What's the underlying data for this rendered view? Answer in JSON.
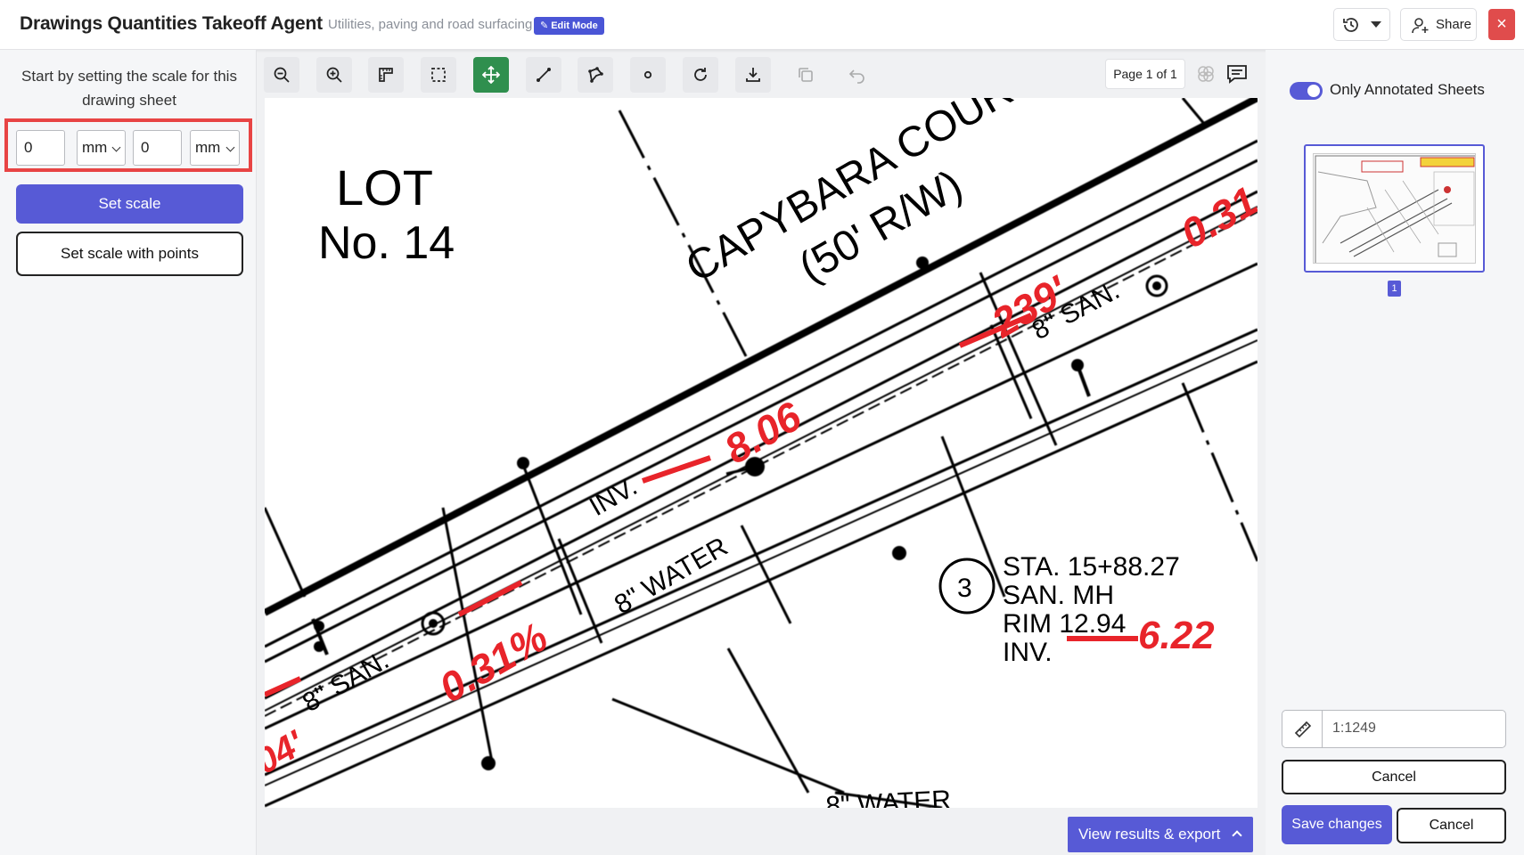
{
  "header": {
    "title": "Drawings Quantities Takeoff Agent",
    "subtitle": "Utilities, paving and road surfacing",
    "mode_badge": "Edit Mode",
    "share_label": "Share",
    "close_label": "×"
  },
  "left_panel": {
    "instruction": "Start by setting the scale for this drawing sheet",
    "scale": {
      "value1": "0",
      "unit1": "mm",
      "value2": "0",
      "unit2": "mm"
    },
    "set_scale_label": "Set scale",
    "set_scale_points_label": "Set scale with points"
  },
  "toolbar": {
    "tools": [
      "zoom-out",
      "zoom-in",
      "ruler-corner",
      "select-area",
      "pan-move",
      "line-measure",
      "polygon-measure",
      "count-point",
      "refresh",
      "download",
      "copy",
      "undo"
    ],
    "active_tool": "pan-move",
    "page_indicator": "Page 1 of 1"
  },
  "drawing": {
    "lot_line1": "LOT",
    "lot_line2": "No.  14",
    "street_name": "CAPYBARA COUR",
    "right_of_way": "(50' R/W)",
    "inv_label": "INV.",
    "inv_value_red": "8.06",
    "elev_239": "239'",
    "slope_031_top": "0.31",
    "slope_031": "0.31%",
    "san_label": "8\" SAN.",
    "water_label": "8\" WATER",
    "water_label_bottom": "8\" WATER",
    "neg_04": "04'",
    "station_number": "3",
    "station_lines": [
      "STA.  15+88.27",
      "SAN.  MH",
      "RIM  12.94",
      "INV."
    ],
    "inv_new_red": "6.22"
  },
  "footer": {
    "results_export_label": "View results & export"
  },
  "right_panel": {
    "toggle_label": "Only Annotated Sheets",
    "toggle_on": true,
    "thumbnail_page": "1",
    "scale_ratio": "1:1249",
    "cancel_wide_label": "Cancel",
    "save_label": "Save changes",
    "cancel_label": "Cancel"
  },
  "colors": {
    "primary": "#575ad6",
    "active_tool": "#2f8f4e",
    "danger": "#e04c4c",
    "markup_red": "#e8242a"
  }
}
